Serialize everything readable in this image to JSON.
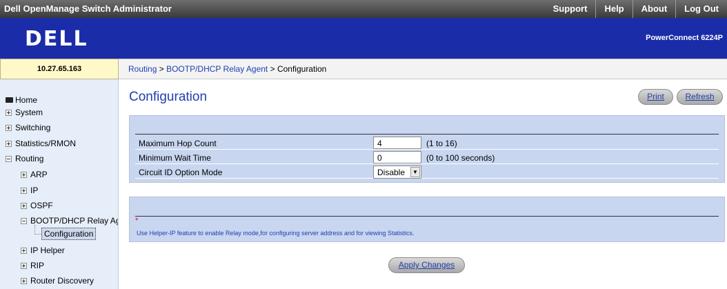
{
  "header": {
    "app_title": "Dell OpenManage Switch Administrator",
    "nav": [
      "Support",
      "Help",
      "About",
      "Log Out"
    ],
    "logo": "DELL",
    "model": "PowerConnect 6224P"
  },
  "ip_address": "10.27.65.163",
  "breadcrumb": {
    "links": [
      "Routing",
      "BOOTP/DHCP Relay Agent"
    ],
    "separator": ">",
    "current": "Configuration"
  },
  "sidebar": {
    "items": [
      {
        "label": "Home"
      },
      {
        "label": "System"
      },
      {
        "label": "Switching"
      },
      {
        "label": "Statistics/RMON"
      },
      {
        "label": "Routing"
      },
      {
        "label": "ARP"
      },
      {
        "label": "IP"
      },
      {
        "label": "OSPF"
      },
      {
        "label": "BOOTP/DHCP Relay Agent"
      },
      {
        "label": "Configuration"
      },
      {
        "label": "IP Helper"
      },
      {
        "label": "RIP"
      },
      {
        "label": "Router Discovery"
      }
    ]
  },
  "main": {
    "title": "Configuration",
    "print_label": "Print",
    "refresh_label": "Refresh",
    "fields": [
      {
        "label": "Maximum Hop Count",
        "value": "4",
        "hint": "(1 to 16)"
      },
      {
        "label": "Minimum Wait Time",
        "value": "0",
        "hint": "(0 to 100 seconds)"
      },
      {
        "label": "Circuit ID Option Mode",
        "value": "Disable",
        "hint": ""
      }
    ],
    "note_marker": "*",
    "note": "Use Helper-IP feature to enable Relay mode,for configuring server address and for viewing Statistics.",
    "apply_label": "Apply Changes"
  }
}
